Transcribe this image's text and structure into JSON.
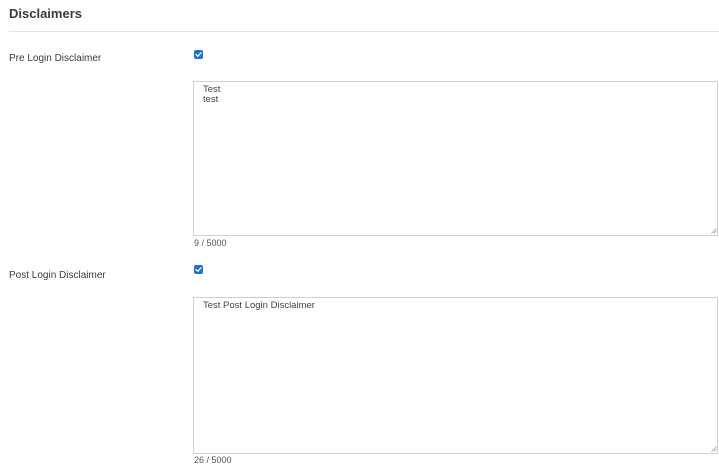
{
  "section": {
    "title": "Disclaimers"
  },
  "pre_login": {
    "label": "Pre Login Disclaimer",
    "checked": true,
    "value": "Test\ntest",
    "counter": "9 / 5000"
  },
  "post_login": {
    "label": "Post Login Disclaimer",
    "checked": true,
    "value": "Test Post Login Disclaimer",
    "counter": "26 / 5000"
  },
  "colors": {
    "checkbox": "#1f74d3",
    "border": "#d0d0d0"
  },
  "icons": {
    "check": "check-icon",
    "resize": "resize-handle-icon"
  }
}
